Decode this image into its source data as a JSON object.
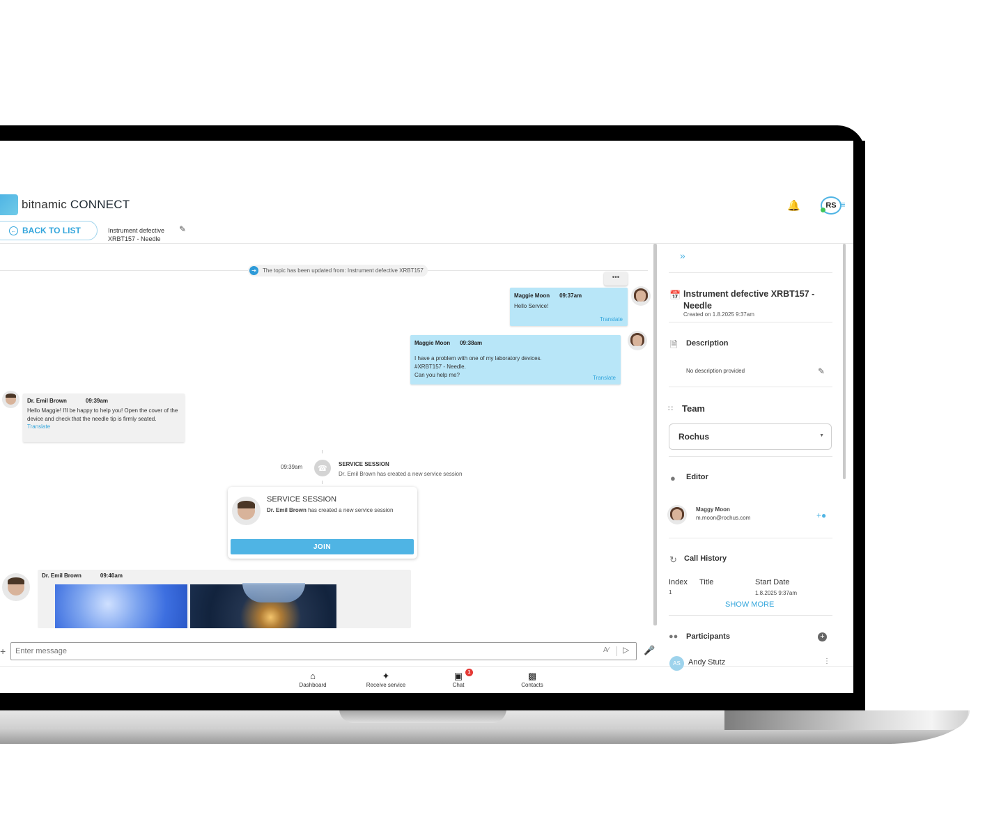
{
  "app": {
    "brand_light": "bitnamic",
    "brand_bold": "CONNECT",
    "user_initials": "RS",
    "accent_color": "#4fb4e4"
  },
  "header": {
    "back_label": "BACK TO LIST",
    "topic_line1": "Instrument defective",
    "topic_line2": "XRBT157 - Needle"
  },
  "chat": {
    "topic_update": "The topic has been updated from: Instrument defective XRBT157",
    "messages": [
      {
        "author": "Maggie Moon",
        "time": "09:37am",
        "text": "Hello Service!",
        "translate": "Translate"
      },
      {
        "author": "Maggie Moon",
        "time": "09:38am",
        "lines": [
          "I have a problem with one of my laboratory devices.",
          "#XRBT157 - Needle.",
          "Can you help me?"
        ],
        "translate": "Translate"
      },
      {
        "author": "Dr. Emil Brown",
        "time": "09:39am",
        "text": "Hello Maggie! I'll be happy to help you! Open the cover of the device and check that the needle tip is firmly seated.",
        "translate": "Translate"
      }
    ],
    "session_event": {
      "time": "09:39am",
      "title": "SERVICE SESSION",
      "text": "Dr. Emil Brown has created a new service session"
    },
    "session_card": {
      "title": "SERVICE SESSION",
      "author": "Dr. Emil Brown",
      "text": "has created a new service session",
      "join_label": "JOIN"
    },
    "image_message": {
      "author": "Dr. Emil Brown",
      "time": "09:40am"
    },
    "input_placeholder": "Enter message"
  },
  "bottom_nav": {
    "items": [
      {
        "label": "Dashboard",
        "icon": "home-icon"
      },
      {
        "label": "Receive service",
        "icon": "person-service-icon"
      },
      {
        "label": "Chat",
        "icon": "chat-icon",
        "badge": "1"
      },
      {
        "label": "Contacts",
        "icon": "contacts-icon"
      }
    ]
  },
  "details": {
    "title": "Instrument defective XRBT157 - Needle",
    "created": "Created on 1.8.2025 9:37am",
    "description_heading": "Description",
    "description_text": "No description provided",
    "team_heading": "Team",
    "team_value": "Rochus",
    "editor_heading": "Editor",
    "editor_name": "Maggy Moon",
    "editor_email": "m.moon@rochus.com",
    "call_history_heading": "Call History",
    "columns": [
      "Index",
      "Title",
      "Start Date"
    ],
    "row": {
      "index": "1",
      "title": "",
      "start": "1.8.2025 9:37am"
    },
    "show_more": "SHOW MORE",
    "participants_heading": "Participants",
    "participant_initials": "AS",
    "participant_name": "Andy Stutz"
  }
}
